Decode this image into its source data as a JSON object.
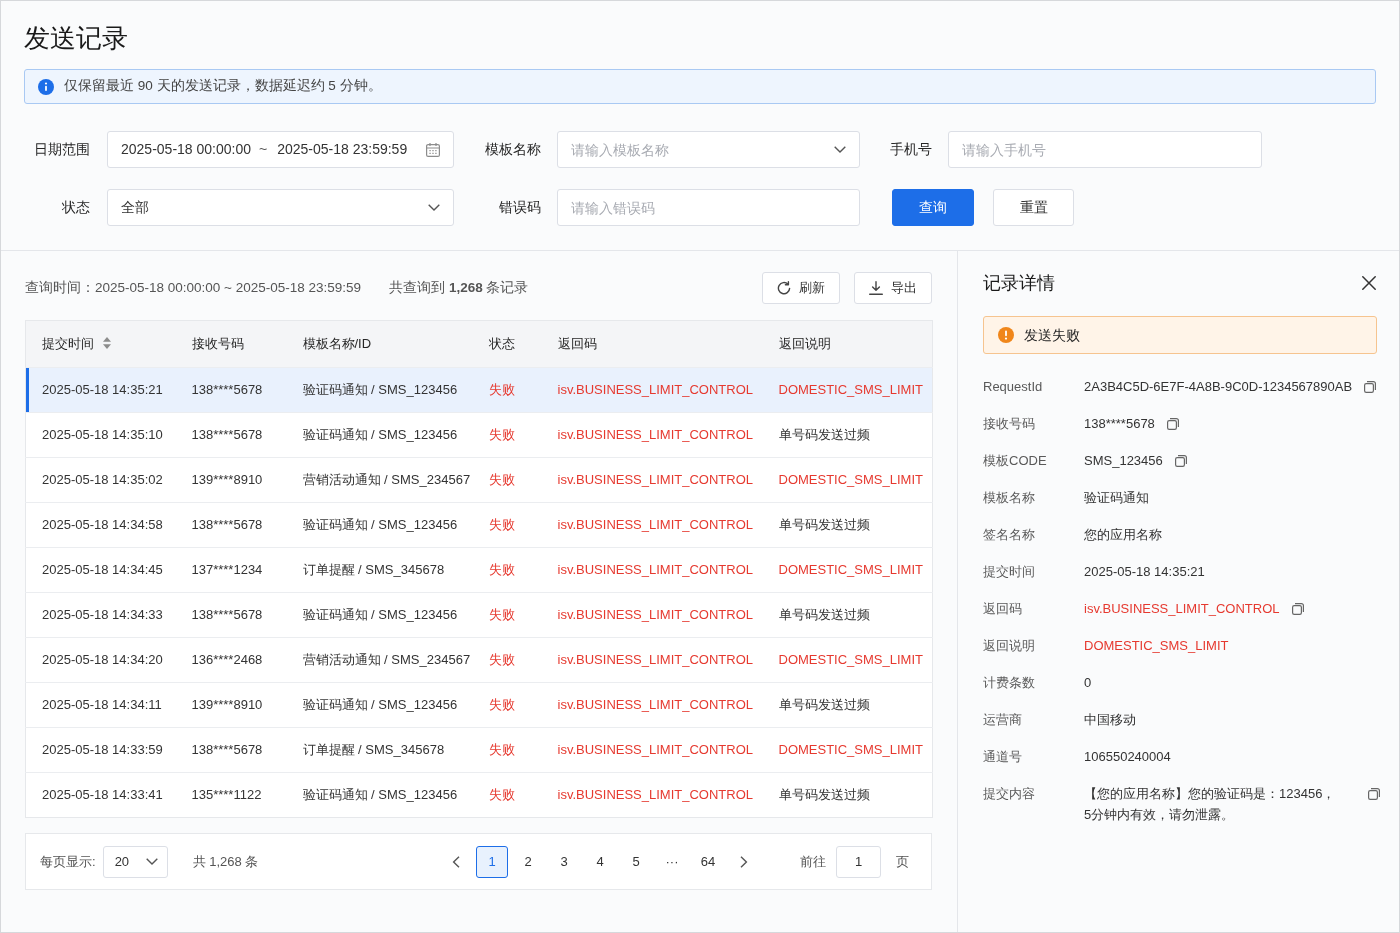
{
  "page": {
    "title": "发送记录"
  },
  "notice": {
    "text": "仅保留最近 90 天的发送记录，数据延迟约 5 分钟。"
  },
  "filters": {
    "rows": [
      {
        "fields": [
          {
            "kind": "date_range",
            "label": "日期范围",
            "start": "2025-05-18 00:00:00",
            "separator": "~",
            "end": "2025-05-18 23:59:59"
          },
          {
            "kind": "select",
            "label": "模板名称",
            "placeholder": "请输入模板名称"
          },
          {
            "kind": "input",
            "label": "手机号",
            "placeholder": "请输入手机号"
          }
        ]
      },
      {
        "fields": [
          {
            "kind": "select",
            "label": "状态",
            "value": "全部"
          },
          {
            "kind": "input",
            "label": "错误码",
            "placeholder": "请输入错误码"
          }
        ],
        "buttons": [
          {
            "kind": "primary",
            "label": "查询"
          },
          {
            "kind": "default",
            "label": "重置"
          }
        ]
      }
    ]
  },
  "results": {
    "query_time": "查询时间：2025-05-18 00:00:00 ~ 2025-05-18 23:59:59",
    "total": "共查询到 **1,268** 条记录",
    "actions": [
      {
        "kind": "refresh",
        "label": "刷新"
      },
      {
        "kind": "export",
        "label": "导出"
      }
    ]
  },
  "table": {
    "columns": [
      {
        "label": "提交时间",
        "sortable": true
      },
      {
        "label": "接收号码",
        "sortable": false
      },
      {
        "label": "模板名称/ID",
        "sortable": false
      },
      {
        "label": "状态",
        "sortable": false
      },
      {
        "label": "返回码",
        "sortable": false
      },
      {
        "label": "返回说明",
        "sortable": false
      }
    ],
    "rows": [
      {
        "submit_time": "2025-05-18 14:35:21",
        "phone": "138****5678",
        "template": "验证码通知 / SMS_123456",
        "status": "失败",
        "return_code": "isv.BUSINESS_LIMIT_CONTROL",
        "return_desc": "DOMESTIC_SMS_LIMIT",
        "failed": true,
        "desc_error": true,
        "selected": true
      },
      {
        "submit_time": "2025-05-18 14:35:10",
        "phone": "138****5678",
        "template": "验证码通知 / SMS_123456",
        "status": "失败",
        "return_code": "isv.BUSINESS_LIMIT_CONTROL",
        "return_desc": "单号码发送过频",
        "failed": true,
        "desc_error": false,
        "selected": false
      },
      {
        "submit_time": "2025-05-18 14:35:02",
        "phone": "139****8910",
        "template": "营销活动通知 / SMS_234567",
        "status": "失败",
        "return_code": "isv.BUSINESS_LIMIT_CONTROL",
        "return_desc": "DOMESTIC_SMS_LIMIT",
        "failed": true,
        "desc_error": true,
        "selected": false
      },
      {
        "submit_time": "2025-05-18 14:34:58",
        "phone": "138****5678",
        "template": "验证码通知 / SMS_123456",
        "status": "失败",
        "return_code": "isv.BUSINESS_LIMIT_CONTROL",
        "return_desc": "单号码发送过频",
        "failed": true,
        "desc_error": false,
        "selected": false
      },
      {
        "submit_time": "2025-05-18 14:34:45",
        "phone": "137****1234",
        "template": "订单提醒 / SMS_345678",
        "status": "失败",
        "return_code": "isv.BUSINESS_LIMIT_CONTROL",
        "return_desc": "DOMESTIC_SMS_LIMIT",
        "failed": true,
        "desc_error": true,
        "selected": false
      },
      {
        "submit_time": "2025-05-18 14:34:33",
        "phone": "138****5678",
        "template": "验证码通知 / SMS_123456",
        "status": "失败",
        "return_code": "isv.BUSINESS_LIMIT_CONTROL",
        "return_desc": "单号码发送过频",
        "failed": true,
        "desc_error": false,
        "selected": false
      },
      {
        "submit_time": "2025-05-18 14:34:20",
        "phone": "136****2468",
        "template": "营销活动通知 / SMS_234567",
        "status": "失败",
        "return_code": "isv.BUSINESS_LIMIT_CONTROL",
        "return_desc": "DOMESTIC_SMS_LIMIT",
        "failed": true,
        "desc_error": true,
        "selected": false
      },
      {
        "submit_time": "2025-05-18 14:34:11",
        "phone": "139****8910",
        "template": "验证码通知 / SMS_123456",
        "status": "失败",
        "return_code": "isv.BUSINESS_LIMIT_CONTROL",
        "return_desc": "单号码发送过频",
        "failed": true,
        "desc_error": false,
        "selected": false
      },
      {
        "submit_time": "2025-05-18 14:33:59",
        "phone": "138****5678",
        "template": "订单提醒 / SMS_345678",
        "status": "失败",
        "return_code": "isv.BUSINESS_LIMIT_CONTROL",
        "return_desc": "DOMESTIC_SMS_LIMIT",
        "failed": true,
        "desc_error": true,
        "selected": false
      },
      {
        "submit_time": "2025-05-18 14:33:41",
        "phone": "135****1122",
        "template": "验证码通知 / SMS_123456",
        "status": "失败",
        "return_code": "isv.BUSINESS_LIMIT_CONTROL",
        "return_desc": "单号码发送过频",
        "failed": true,
        "desc_error": false,
        "selected": false
      }
    ]
  },
  "pagination": {
    "page_size_label": "每页显示:",
    "page_size": "20",
    "total": "共 1,268 条",
    "pages": [
      {
        "kind": "page",
        "label": "1",
        "selected": true
      },
      {
        "kind": "page",
        "label": "2",
        "selected": false
      },
      {
        "kind": "page",
        "label": "3",
        "selected": false
      },
      {
        "kind": "page",
        "label": "4",
        "selected": false
      },
      {
        "kind": "page",
        "label": "5",
        "selected": false
      },
      {
        "kind": "ellipsis",
        "label": "···",
        "selected": false
      },
      {
        "kind": "page",
        "label": "64",
        "selected": false
      }
    ],
    "goto_label": "前往",
    "goto_value": "1",
    "goto_suffix": "页"
  },
  "detail_panel": {
    "title": "记录详情",
    "alert": {
      "text": "发送失败"
    },
    "items": [
      {
        "label": "RequestId",
        "value": "2A3B4C5D-6E7F-4A8B-9C0D-1234567890AB",
        "error": false,
        "copyable": true
      },
      {
        "label": "接收号码",
        "value": "138****5678",
        "error": false,
        "copyable": true
      },
      {
        "label": "模板CODE",
        "value": "SMS_123456",
        "error": false,
        "copyable": true
      },
      {
        "label": "模板名称",
        "value": "验证码通知",
        "error": false,
        "copyable": false
      },
      {
        "label": "签名名称",
        "value": "您的应用名称",
        "error": false,
        "copyable": false
      },
      {
        "label": "提交时间",
        "value": "2025-05-18 14:35:21",
        "error": false,
        "copyable": false
      },
      {
        "label": "返回码",
        "value": "isv.BUSINESS_LIMIT_CONTROL",
        "error": true,
        "copyable": true
      },
      {
        "label": "返回说明",
        "value": "DOMESTIC_SMS_LIMIT",
        "error": true,
        "copyable": false
      },
      {
        "label": "计费条数",
        "value": "0",
        "error": false,
        "copyable": false
      },
      {
        "label": "运营商",
        "value": "中国移动",
        "error": false,
        "copyable": false
      },
      {
        "label": "通道号",
        "value": "106550240004",
        "error": false,
        "copyable": false
      },
      {
        "label": "提交内容",
        "value": "【您的应用名称】您的验证码是：123456，5分钟内有效，请勿泄露。",
        "error": false,
        "copyable": true
      }
    ]
  }
}
